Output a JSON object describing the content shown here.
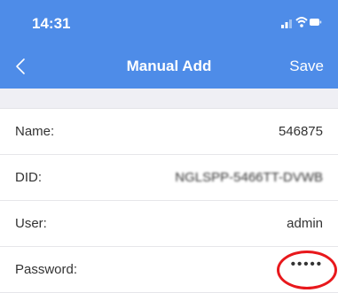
{
  "status": {
    "time": "14:31",
    "icons": [
      "signal-icon",
      "wifi-icon",
      "battery-icon"
    ]
  },
  "nav": {
    "back_icon": "chevron-left-icon",
    "title": "Manual Add",
    "save_label": "Save"
  },
  "form": {
    "fields": [
      {
        "label": "Name:",
        "value": "546875"
      },
      {
        "label": "DID:",
        "value": "NGLSPP-5466TT-DVWB"
      },
      {
        "label": "User:",
        "value": "admin"
      },
      {
        "label": "Password:",
        "value": "•••••"
      }
    ]
  },
  "colors": {
    "header": "#4e8ce8",
    "background": "#efeff4",
    "highlight": "#e8181c"
  }
}
